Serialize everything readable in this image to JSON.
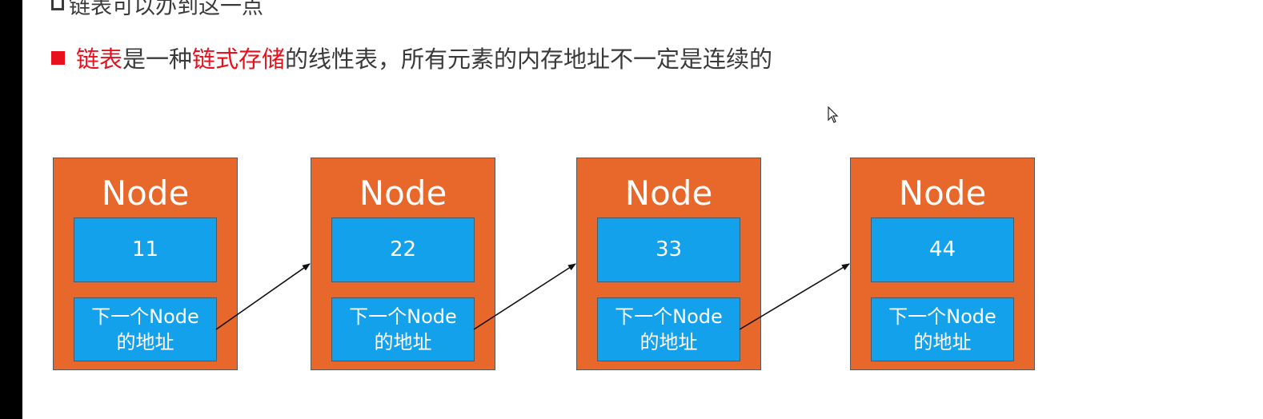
{
  "top_line": {
    "text": "链表可以办到这一点"
  },
  "bullet": {
    "seg1": "链表",
    "seg2": "是一种",
    "seg3": "链式存储",
    "seg4": "的线性表，所有元素的内存地址不一定是连续的"
  },
  "nodes": [
    {
      "title": "Node",
      "value": "11",
      "next_line1": "下一个Node",
      "next_line2": "的地址"
    },
    {
      "title": "Node",
      "value": "22",
      "next_line1": "下一个Node",
      "next_line2": "的地址"
    },
    {
      "title": "Node",
      "value": "33",
      "next_line1": "下一个Node",
      "next_line2": "的地址"
    },
    {
      "title": "Node",
      "value": "44",
      "next_line1": "下一个Node",
      "next_line2": "的地址"
    }
  ],
  "colors": {
    "node_fill": "#e8672a",
    "field_fill": "#13a1ec",
    "highlight_red": "#e8101c",
    "text_dark": "#3a3a3a"
  },
  "icons": {
    "bullet_top": "hollow-square-icon",
    "bullet_main": "red-square-icon",
    "pointer": "mouse-cursor-icon"
  }
}
